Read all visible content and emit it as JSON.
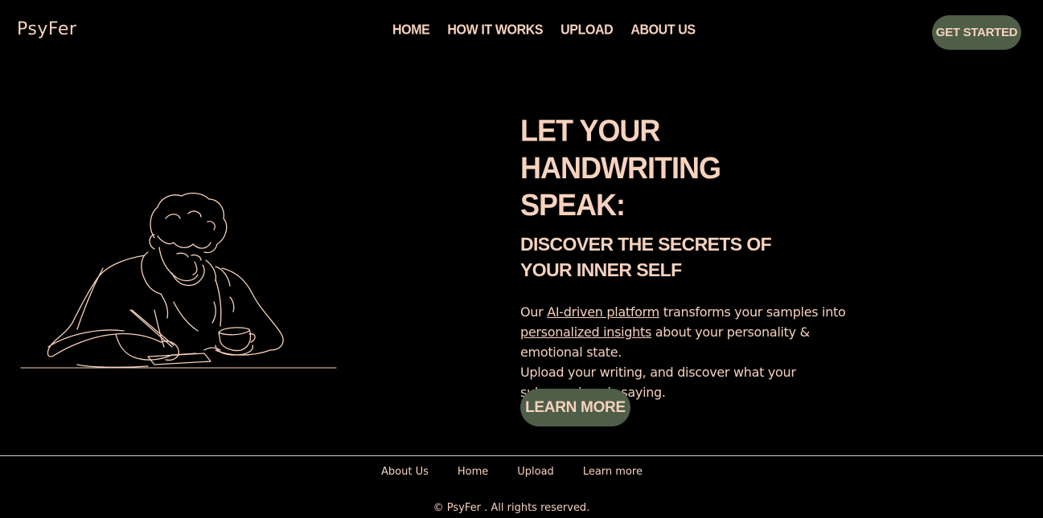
{
  "brand": {
    "logo": "PsyFer"
  },
  "nav": {
    "items": [
      {
        "label": "HOME"
      },
      {
        "label": "HOW IT WORKS"
      },
      {
        "label": "UPLOAD"
      },
      {
        "label": "ABOUT US"
      }
    ],
    "cta_label": "GET STARTED"
  },
  "hero": {
    "title": "LET YOUR HANDWRITING SPEAK:",
    "subtitle": "DISCOVER THE SECRETS OF YOUR INNER SELF",
    "desc": {
      "part1": "Our ",
      "link1": "AI-driven platform",
      "part2": " transforms your samples into ",
      "link2": "personalized insights",
      "part3": " about your personality & emotional state.",
      "line2": "Upload your writing, and discover what your subconscious is saying."
    },
    "cta_label": "LEARN MORE"
  },
  "illustration": {
    "icon": "person-writing-line-art-icon"
  },
  "footer": {
    "links": [
      {
        "label": "About Us"
      },
      {
        "label": "Home"
      },
      {
        "label": "Upload"
      },
      {
        "label": "Learn more"
      }
    ],
    "copyright": "© PsyFer . All rights reserved."
  },
  "colors": {
    "background": "#000000",
    "text": "#f7d2bd",
    "button": "#4e5e49"
  }
}
